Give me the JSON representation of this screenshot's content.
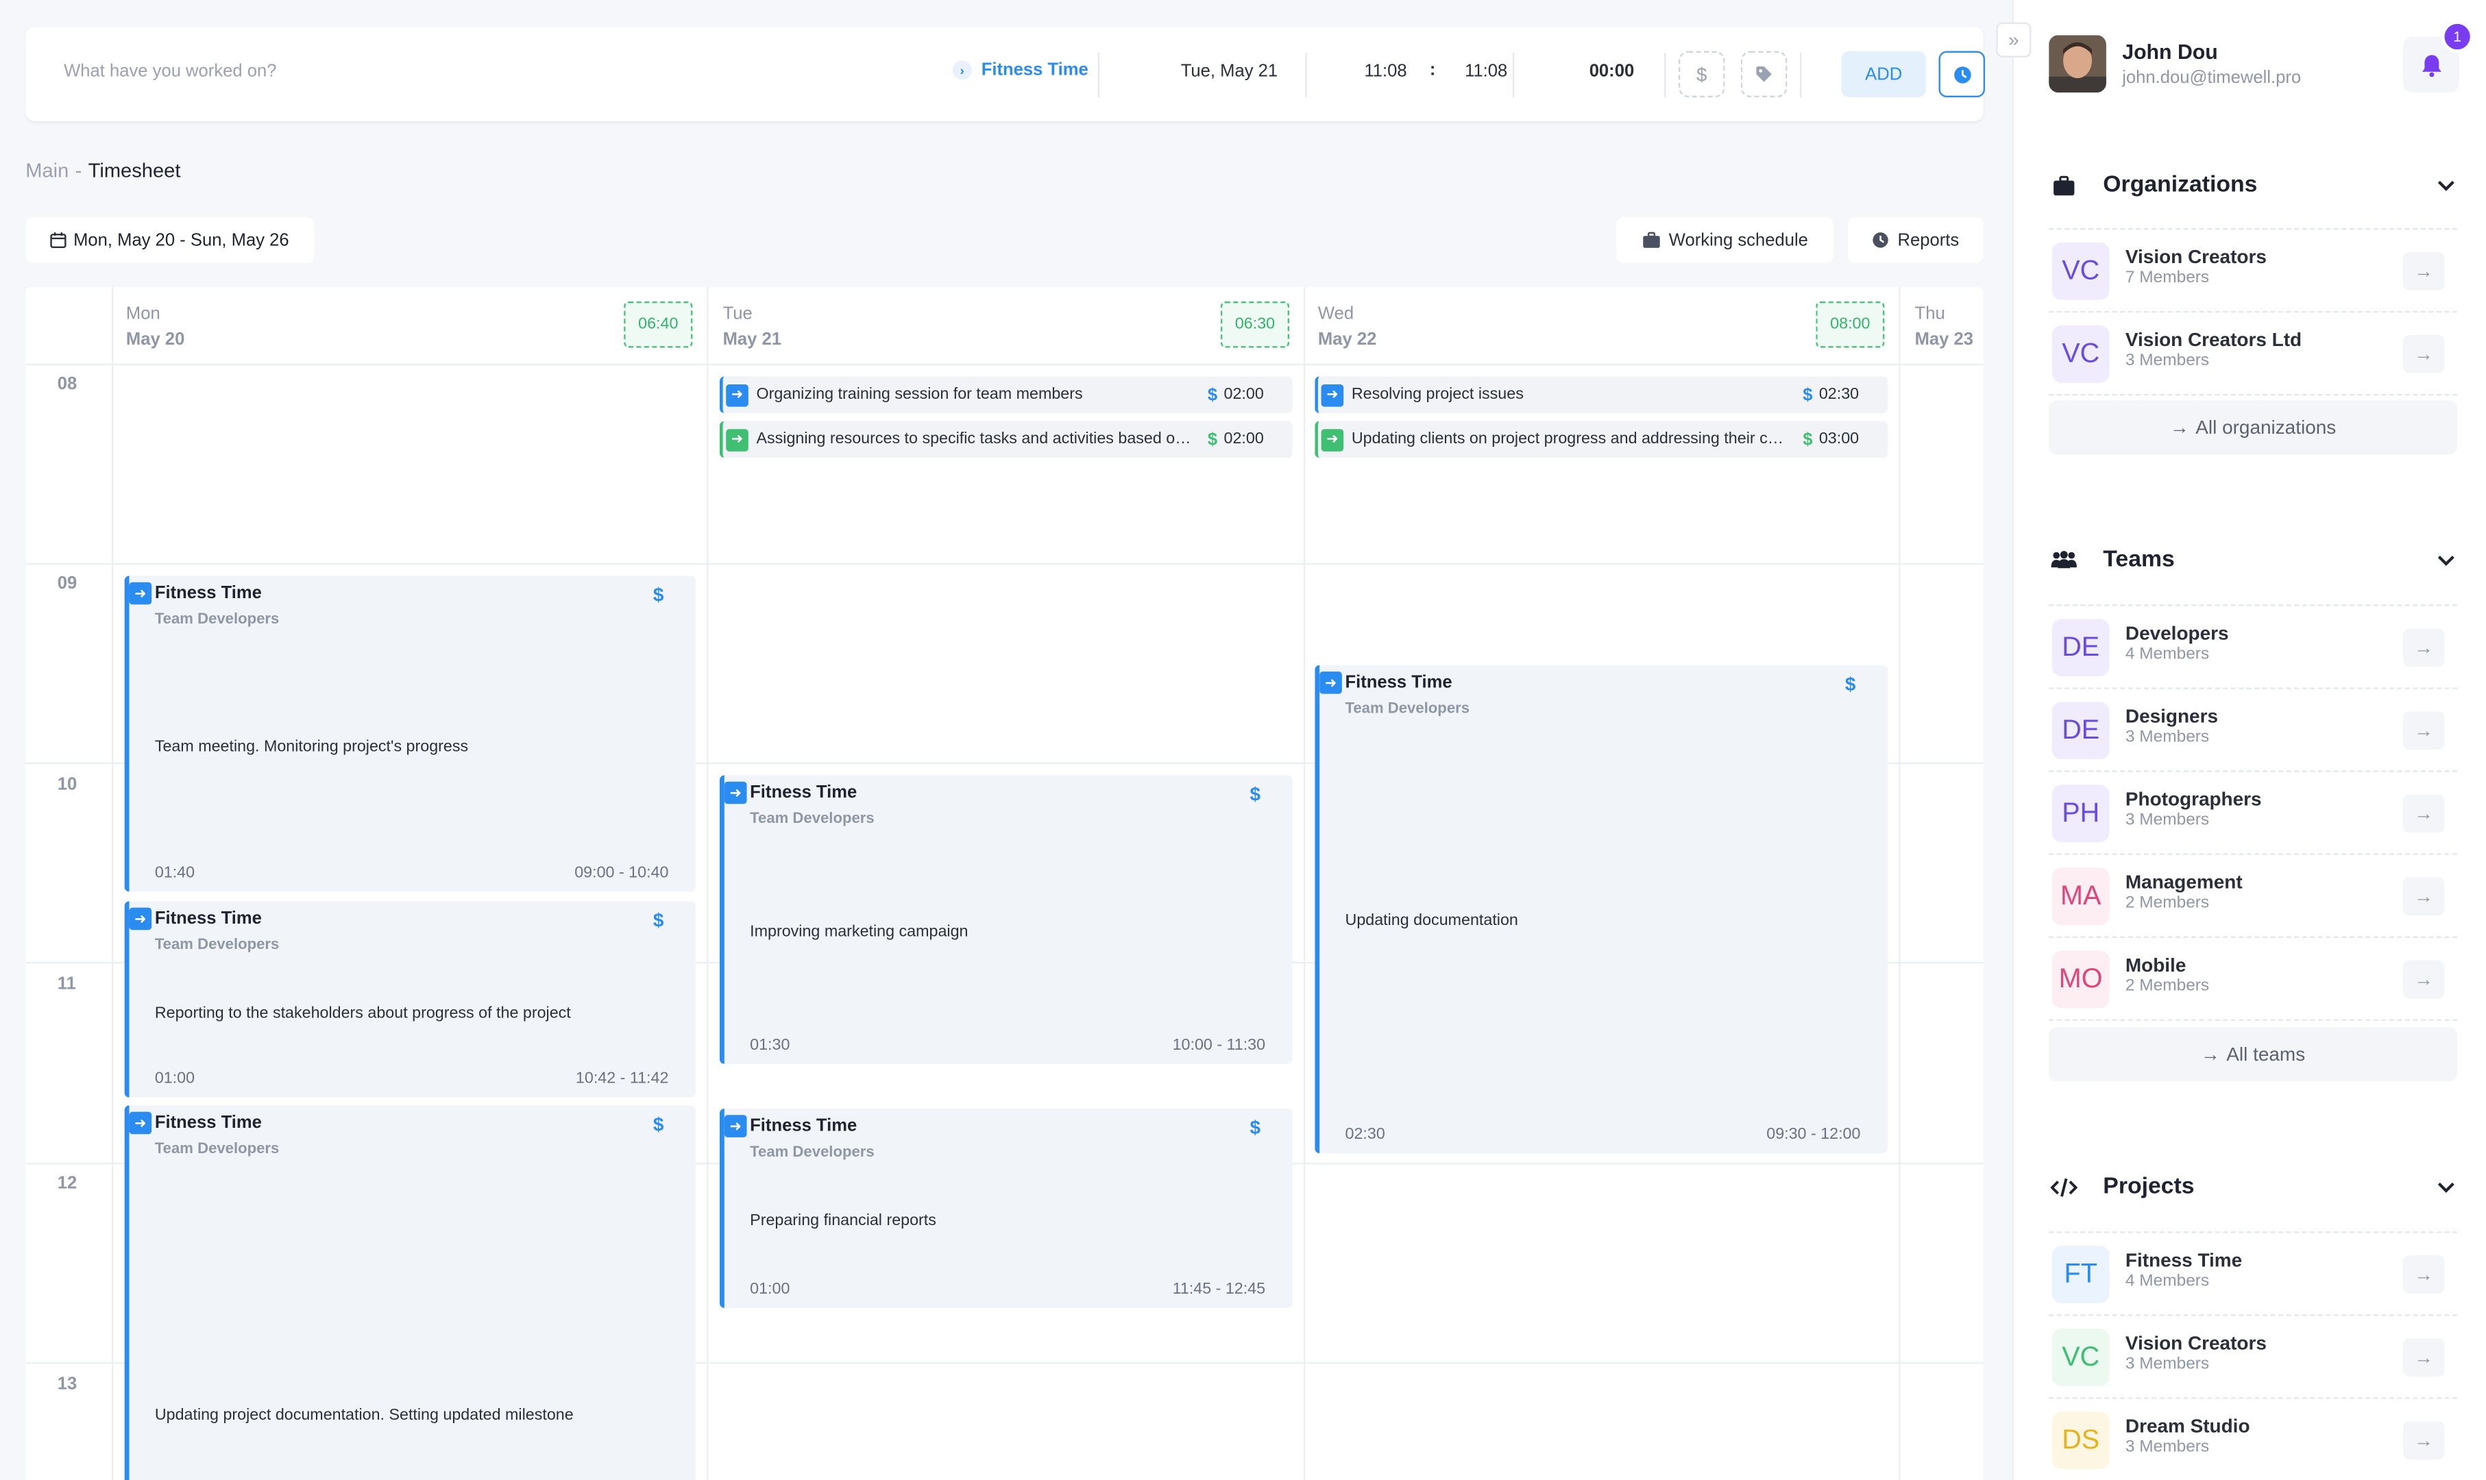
{
  "tracker": {
    "placeholder": "What have you worked on?",
    "project": "Fitness Time",
    "date": "Tue, May 21",
    "start": "11:08",
    "colon": ":",
    "end": "11:08",
    "duration": "00:00",
    "add_label": "ADD",
    "billable_icon": "$",
    "tag_icon": "tag-icon"
  },
  "breadcrumb": {
    "root": "Main",
    "sep": "-",
    "current": "Timesheet"
  },
  "toolbar": {
    "range": "Mon, May 20 - Sun, May 26",
    "working_schedule": "Working schedule",
    "reports": "Reports"
  },
  "calendar": {
    "days": [
      {
        "name": "Mon",
        "date": "May 20",
        "total": "06:40"
      },
      {
        "name": "Tue",
        "date": "May 21",
        "total": "06:30"
      },
      {
        "name": "Wed",
        "date": "May 22",
        "total": "08:00"
      },
      {
        "name": "Thu",
        "date": "May 23"
      }
    ],
    "hours": [
      "08",
      "09",
      "10",
      "11",
      "12",
      "13"
    ],
    "pills": [
      {
        "text": "Organizing training session for team members",
        "dollar": "$",
        "time": "02:00"
      },
      {
        "text": "Assigning resources to specific tasks and activities based on their availability",
        "dollar": "$",
        "time": "02:00"
      },
      {
        "text": "Resolving project issues",
        "dollar": "$",
        "time": "02:30"
      },
      {
        "text": "Updating clients on project progress and addressing their concerns",
        "dollar": "$",
        "time": "03:00"
      }
    ],
    "events": [
      {
        "title": "Fitness Time",
        "team": "Team Developers",
        "dollar": "$",
        "desc": "Team meeting. Monitoring project's progress",
        "duration": "01:40",
        "range": "09:00 - 10:40"
      },
      {
        "title": "Fitness Time",
        "team": "Team Developers",
        "dollar": "$",
        "desc": "Reporting to the stakeholders about progress of the project",
        "duration": "01:00",
        "range": "10:42 - 11:42"
      },
      {
        "title": "Fitness Time",
        "team": "Team Developers",
        "dollar": "$",
        "desc": "Updating project documentation. Setting updated milestone"
      },
      {
        "title": "Fitness Time",
        "team": "Team Developers",
        "dollar": "$",
        "desc": "Improving marketing campaign",
        "duration": "01:30",
        "range": "10:00 - 11:30"
      },
      {
        "title": "Fitness Time",
        "team": "Team Developers",
        "dollar": "$",
        "desc": "Preparing financial reports",
        "duration": "01:00",
        "range": "11:45 - 12:45"
      },
      {
        "title": "Fitness Time",
        "team": "Team Developers",
        "dollar": "$",
        "desc": "Updating documentation",
        "duration": "02:30",
        "range": "09:30 - 12:00"
      }
    ]
  },
  "user": {
    "name": "John Dou",
    "email": "john.dou@timewell.pro",
    "notifications": "1"
  },
  "organizations": {
    "title": "Organizations",
    "items": [
      {
        "initials": "VC",
        "name": "Vision Creators",
        "members": "7 Members",
        "color": "#6a4ce0",
        "bg": "#f0ecfd"
      },
      {
        "initials": "VC",
        "name": "Vision Creators Ltd",
        "members": "3 Members",
        "color": "#6a4ce0",
        "bg": "#f0ecfd"
      }
    ],
    "all_label": "All organizations"
  },
  "teams": {
    "title": "Teams",
    "items": [
      {
        "initials": "DE",
        "name": "Developers",
        "members": "4 Members",
        "color": "#6a4ce0",
        "bg": "#f0ecfd"
      },
      {
        "initials": "DE",
        "name": "Designers",
        "members": "3 Members",
        "color": "#6a4ce0",
        "bg": "#f0ecfd"
      },
      {
        "initials": "PH",
        "name": "Photographers",
        "members": "3 Members",
        "color": "#6a4ce0",
        "bg": "#f0ecfd"
      },
      {
        "initials": "MA",
        "name": "Management",
        "members": "2 Members",
        "color": "#e0457a",
        "bg": "#fdeef3"
      },
      {
        "initials": "MO",
        "name": "Mobile",
        "members": "2 Members",
        "color": "#e0457a",
        "bg": "#fdeef3"
      }
    ],
    "all_label": "All teams"
  },
  "projects": {
    "title": "Projects",
    "items": [
      {
        "initials": "FT",
        "name": "Fitness Time",
        "members": "4 Members",
        "color": "#2a8cf0",
        "bg": "#eaf3fe"
      },
      {
        "initials": "VC",
        "name": "Vision Creators",
        "members": "3 Members",
        "color": "#3fbf72",
        "bg": "#ebf9f1"
      },
      {
        "initials": "DS",
        "name": "Dream Studio",
        "members": "3 Members",
        "color": "#e8b21c",
        "bg": "#fdf6e3"
      }
    ]
  }
}
